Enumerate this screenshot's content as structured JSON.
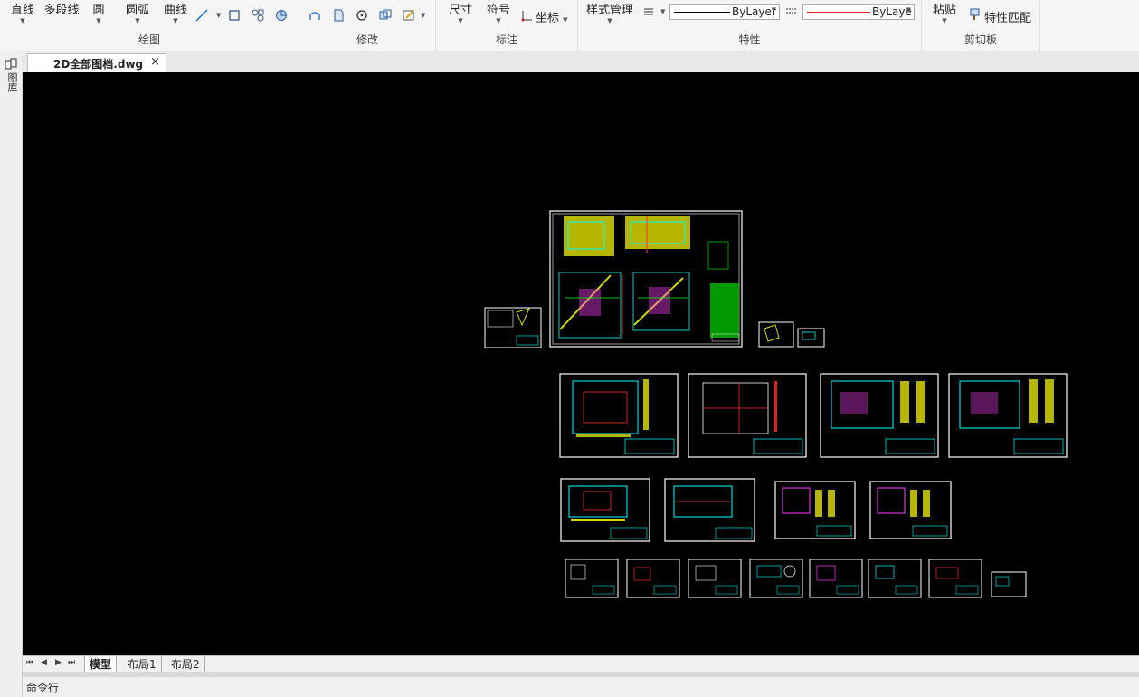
{
  "ribbon": {
    "groups": {
      "draw": {
        "label": "绘图",
        "buttons": [
          "直线",
          "多段线",
          "圆",
          "圆弧",
          "曲线"
        ]
      },
      "modify": {
        "label": "修改"
      },
      "annotate": {
        "label": "标注",
        "buttons": [
          "尺寸",
          "符号"
        ],
        "coord_label": "坐标"
      },
      "properties": {
        "label": "特性",
        "style_manager": "样式管理",
        "linetype": "ByLayer",
        "color": "ByLaye"
      },
      "clipboard": {
        "label": "剪切板",
        "paste": "粘贴",
        "match_properties": "特性匹配"
      }
    },
    "colors": {
      "linetype_line": "#000000",
      "color_line": "#e02020"
    }
  },
  "left_panel": {
    "label": "图库"
  },
  "document": {
    "tab_title": "2D全部图档.dwg",
    "close": "×"
  },
  "layout_tabs": [
    "模型",
    "布局1",
    "布局2"
  ],
  "command_line": {
    "label": "命令行"
  }
}
